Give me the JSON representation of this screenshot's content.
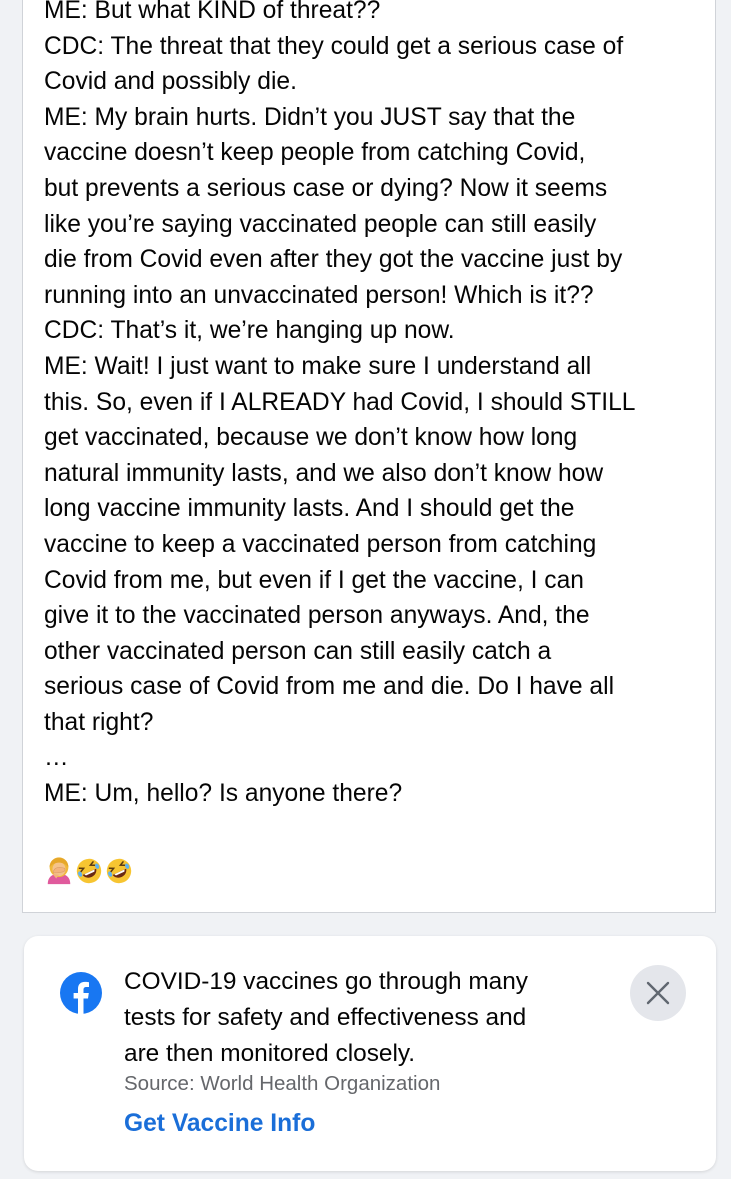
{
  "post": {
    "lines": [
      "ME: But what KIND of threat??",
      "CDC: The threat that they could get a serious case of",
      "Covid and possibly die.",
      "ME: My brain hurts. Didn’t you JUST say that the",
      "vaccine doesn’t keep people from catching Covid,",
      "but prevents a serious case or dying?  Now it seems",
      "like you’re saying vaccinated people can still easily",
      "die from Covid even after they got the vaccine just by",
      "running into an unvaccinated person! Which is it??",
      "CDC: That’s it, we’re hanging up now.",
      "ME: Wait! I just want to make sure I understand all",
      "this. So, even if I ALREADY had Covid, I should STILL",
      "get vaccinated, because we don’t know how long",
      "natural immunity lasts, and we also don’t know how",
      "long vaccine immunity lasts. And I should get the",
      "vaccine to keep a vaccinated person from catching",
      "Covid from me, but even if I get the vaccine, I can",
      "give it to the vaccinated person anyways. And, the",
      "other vaccinated person can still easily catch a",
      "serious case of Covid from me and die. Do I have all",
      "that right?",
      "…",
      "ME: Um, hello? Is anyone there?"
    ],
    "emojis": [
      "woman-facepalming-icon",
      "rolling-on-floor-laughing-icon",
      "rolling-on-floor-laughing-icon"
    ]
  },
  "info_card": {
    "icon": "facebook-logo-icon",
    "lines": [
      "COVID-19 vaccines go through many",
      "tests for safety and effectiveness and",
      "are then monitored closely."
    ],
    "source": "Source: World Health Organization",
    "cta_label": "Get Vaccine Info",
    "close_icon": "close-icon"
  },
  "colors": {
    "brand_blue": "#1877f2",
    "link_blue": "#1a6ed8",
    "text": "#050505",
    "secondary_text": "#65676b",
    "background": "#f0f2f5"
  }
}
